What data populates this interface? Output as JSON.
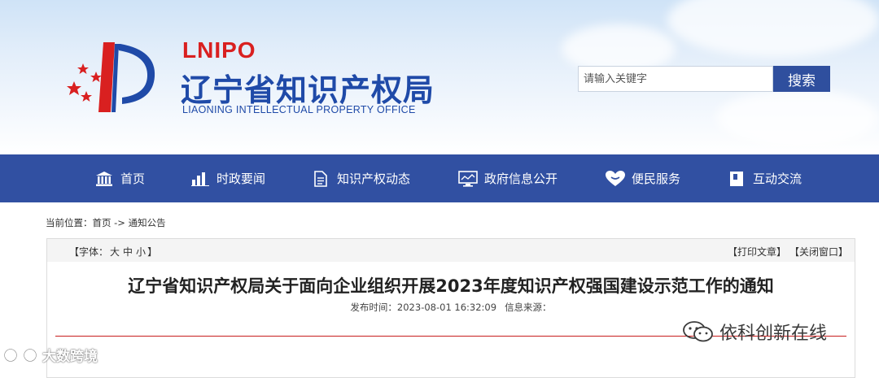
{
  "header": {
    "brand_en": "LNIPO",
    "brand_cn": "辽宁省知识产权局",
    "brand_subtitle": "LIAONING INTELLECTUAL PROPERTY OFFICE",
    "search": {
      "placeholder": "请输入关键字",
      "button_label": "搜索"
    },
    "colors": {
      "brand_blue": "#1f4aa8",
      "brand_red": "#d92020"
    }
  },
  "nav": {
    "background": "#3150a2",
    "items": [
      {
        "label": "首页",
        "icon": "home-icon"
      },
      {
        "label": "时政要闻",
        "icon": "bar-chart-icon"
      },
      {
        "label": "知识产权动态",
        "icon": "document-icon"
      },
      {
        "label": "政府信息公开",
        "icon": "monitor-icon"
      },
      {
        "label": "便民服务",
        "icon": "heart-icon"
      },
      {
        "label": "互动交流",
        "icon": "bookmark-icon"
      }
    ]
  },
  "breadcrumb": {
    "prefix": "当前位置：",
    "home": "首页",
    "separator": " -> ",
    "current": "通知公告"
  },
  "article": {
    "font_size_label": "【字体：",
    "font_sizes": [
      "大",
      "中",
      "小"
    ],
    "font_size_close": "】",
    "print_label": "【打印文章】",
    "close_label": "【关闭窗口】",
    "title": "辽宁省知识产权局关于面向企业组织开展2023年度知识产权强国建设示范工作的通知",
    "publish_label": "发布时间：",
    "publish_time": "2023-08-01 16:32:09",
    "source_label": "信息来源："
  },
  "watermarks": {
    "right": "依科创新在线",
    "left": "大数跨境"
  }
}
